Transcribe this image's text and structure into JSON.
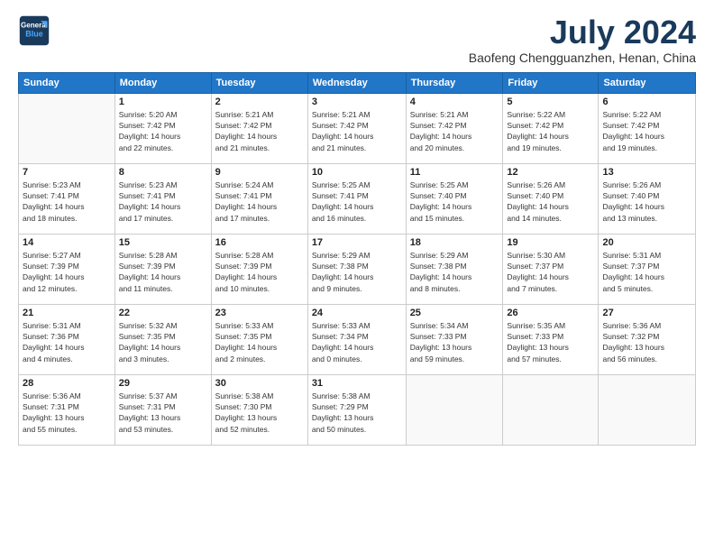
{
  "header": {
    "logo_line1": "General",
    "logo_line2": "Blue",
    "month": "July 2024",
    "location": "Baofeng Chengguanzhen, Henan, China"
  },
  "days_of_week": [
    "Sunday",
    "Monday",
    "Tuesday",
    "Wednesday",
    "Thursday",
    "Friday",
    "Saturday"
  ],
  "weeks": [
    [
      {
        "day": "",
        "info": ""
      },
      {
        "day": "1",
        "info": "Sunrise: 5:20 AM\nSunset: 7:42 PM\nDaylight: 14 hours\nand 22 minutes."
      },
      {
        "day": "2",
        "info": "Sunrise: 5:21 AM\nSunset: 7:42 PM\nDaylight: 14 hours\nand 21 minutes."
      },
      {
        "day": "3",
        "info": "Sunrise: 5:21 AM\nSunset: 7:42 PM\nDaylight: 14 hours\nand 21 minutes."
      },
      {
        "day": "4",
        "info": "Sunrise: 5:21 AM\nSunset: 7:42 PM\nDaylight: 14 hours\nand 20 minutes."
      },
      {
        "day": "5",
        "info": "Sunrise: 5:22 AM\nSunset: 7:42 PM\nDaylight: 14 hours\nand 19 minutes."
      },
      {
        "day": "6",
        "info": "Sunrise: 5:22 AM\nSunset: 7:42 PM\nDaylight: 14 hours\nand 19 minutes."
      }
    ],
    [
      {
        "day": "7",
        "info": "Sunrise: 5:23 AM\nSunset: 7:41 PM\nDaylight: 14 hours\nand 18 minutes."
      },
      {
        "day": "8",
        "info": "Sunrise: 5:23 AM\nSunset: 7:41 PM\nDaylight: 14 hours\nand 17 minutes."
      },
      {
        "day": "9",
        "info": "Sunrise: 5:24 AM\nSunset: 7:41 PM\nDaylight: 14 hours\nand 17 minutes."
      },
      {
        "day": "10",
        "info": "Sunrise: 5:25 AM\nSunset: 7:41 PM\nDaylight: 14 hours\nand 16 minutes."
      },
      {
        "day": "11",
        "info": "Sunrise: 5:25 AM\nSunset: 7:40 PM\nDaylight: 14 hours\nand 15 minutes."
      },
      {
        "day": "12",
        "info": "Sunrise: 5:26 AM\nSunset: 7:40 PM\nDaylight: 14 hours\nand 14 minutes."
      },
      {
        "day": "13",
        "info": "Sunrise: 5:26 AM\nSunset: 7:40 PM\nDaylight: 14 hours\nand 13 minutes."
      }
    ],
    [
      {
        "day": "14",
        "info": "Sunrise: 5:27 AM\nSunset: 7:39 PM\nDaylight: 14 hours\nand 12 minutes."
      },
      {
        "day": "15",
        "info": "Sunrise: 5:28 AM\nSunset: 7:39 PM\nDaylight: 14 hours\nand 11 minutes."
      },
      {
        "day": "16",
        "info": "Sunrise: 5:28 AM\nSunset: 7:39 PM\nDaylight: 14 hours\nand 10 minutes."
      },
      {
        "day": "17",
        "info": "Sunrise: 5:29 AM\nSunset: 7:38 PM\nDaylight: 14 hours\nand 9 minutes."
      },
      {
        "day": "18",
        "info": "Sunrise: 5:29 AM\nSunset: 7:38 PM\nDaylight: 14 hours\nand 8 minutes."
      },
      {
        "day": "19",
        "info": "Sunrise: 5:30 AM\nSunset: 7:37 PM\nDaylight: 14 hours\nand 7 minutes."
      },
      {
        "day": "20",
        "info": "Sunrise: 5:31 AM\nSunset: 7:37 PM\nDaylight: 14 hours\nand 5 minutes."
      }
    ],
    [
      {
        "day": "21",
        "info": "Sunrise: 5:31 AM\nSunset: 7:36 PM\nDaylight: 14 hours\nand 4 minutes."
      },
      {
        "day": "22",
        "info": "Sunrise: 5:32 AM\nSunset: 7:35 PM\nDaylight: 14 hours\nand 3 minutes."
      },
      {
        "day": "23",
        "info": "Sunrise: 5:33 AM\nSunset: 7:35 PM\nDaylight: 14 hours\nand 2 minutes."
      },
      {
        "day": "24",
        "info": "Sunrise: 5:33 AM\nSunset: 7:34 PM\nDaylight: 14 hours\nand 0 minutes."
      },
      {
        "day": "25",
        "info": "Sunrise: 5:34 AM\nSunset: 7:33 PM\nDaylight: 13 hours\nand 59 minutes."
      },
      {
        "day": "26",
        "info": "Sunrise: 5:35 AM\nSunset: 7:33 PM\nDaylight: 13 hours\nand 57 minutes."
      },
      {
        "day": "27",
        "info": "Sunrise: 5:36 AM\nSunset: 7:32 PM\nDaylight: 13 hours\nand 56 minutes."
      }
    ],
    [
      {
        "day": "28",
        "info": "Sunrise: 5:36 AM\nSunset: 7:31 PM\nDaylight: 13 hours\nand 55 minutes."
      },
      {
        "day": "29",
        "info": "Sunrise: 5:37 AM\nSunset: 7:31 PM\nDaylight: 13 hours\nand 53 minutes."
      },
      {
        "day": "30",
        "info": "Sunrise: 5:38 AM\nSunset: 7:30 PM\nDaylight: 13 hours\nand 52 minutes."
      },
      {
        "day": "31",
        "info": "Sunrise: 5:38 AM\nSunset: 7:29 PM\nDaylight: 13 hours\nand 50 minutes."
      },
      {
        "day": "",
        "info": ""
      },
      {
        "day": "",
        "info": ""
      },
      {
        "day": "",
        "info": ""
      }
    ]
  ]
}
